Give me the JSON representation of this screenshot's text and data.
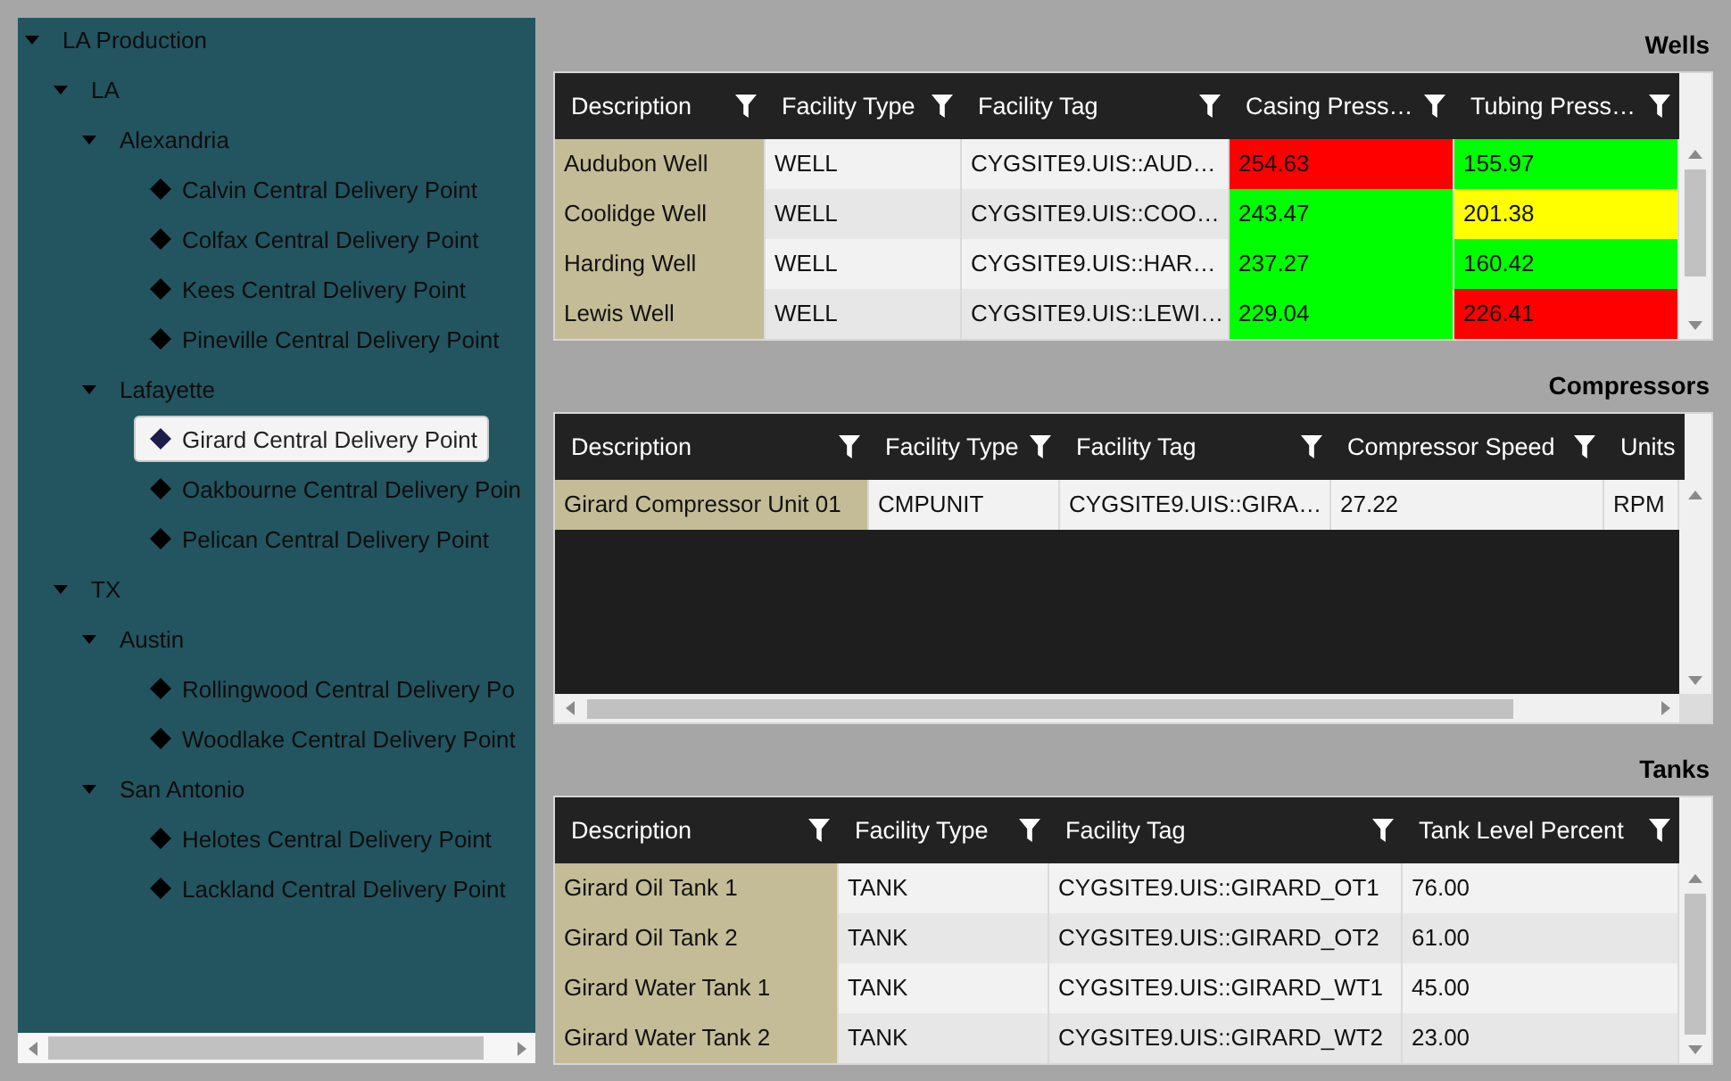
{
  "tree": [
    {
      "label": "LA Production",
      "expanded": true,
      "selected": false,
      "children": [
        {
          "label": "LA",
          "expanded": true,
          "selected": false,
          "children": [
            {
              "label": "Alexandria",
              "expanded": true,
              "selected": false,
              "children": [
                {
                  "label": "Calvin Central Delivery Point",
                  "selected": false
                },
                {
                  "label": "Colfax Central Delivery Point",
                  "selected": false
                },
                {
                  "label": "Kees Central Delivery Point",
                  "selected": false
                },
                {
                  "label": "Pineville Central Delivery Point",
                  "selected": false
                }
              ]
            },
            {
              "label": "Lafayette",
              "expanded": true,
              "selected": false,
              "children": [
                {
                  "label": "Girard Central Delivery Point",
                  "selected": true
                },
                {
                  "label": "Oakbourne Central Delivery Poin",
                  "selected": false
                },
                {
                  "label": "Pelican Central Delivery Point",
                  "selected": false
                }
              ]
            }
          ]
        },
        {
          "label": "TX",
          "expanded": true,
          "selected": false,
          "children": [
            {
              "label": "Austin",
              "expanded": true,
              "selected": false,
              "children": [
                {
                  "label": "Rollingwood Central Delivery Po",
                  "selected": false
                },
                {
                  "label": "Woodlake Central Delivery Point",
                  "selected": false
                }
              ]
            },
            {
              "label": "San Antonio",
              "expanded": true,
              "selected": false,
              "children": [
                {
                  "label": "Helotes Central Delivery Point",
                  "selected": false
                },
                {
                  "label": "Lackland Central Delivery Point",
                  "selected": false
                }
              ]
            }
          ]
        }
      ]
    }
  ],
  "sections": [
    {
      "title": "Wells",
      "horizontal_scroll": false,
      "columns": [
        {
          "label": "Description",
          "filter": true
        },
        {
          "label": "Facility Type",
          "filter": true
        },
        {
          "label": "Facility Tag",
          "filter": true
        },
        {
          "label": "Casing Press…",
          "filter": true
        },
        {
          "label": "Tubing Press…",
          "filter": true
        }
      ],
      "rows": [
        {
          "cells": [
            {
              "text": "Audubon Well"
            },
            {
              "text": "WELL"
            },
            {
              "text": "CYGSITE9.UIS::AUD…"
            },
            {
              "text": "254.63",
              "color": "#ff0000"
            },
            {
              "text": "155.97",
              "color": "#00ff00"
            }
          ]
        },
        {
          "cells": [
            {
              "text": "Coolidge Well"
            },
            {
              "text": "WELL"
            },
            {
              "text": "CYGSITE9.UIS::COO…"
            },
            {
              "text": "243.47",
              "color": "#00ff00"
            },
            {
              "text": "201.38",
              "color": "#ffff00"
            }
          ]
        },
        {
          "cells": [
            {
              "text": "Harding Well"
            },
            {
              "text": "WELL"
            },
            {
              "text": "CYGSITE9.UIS::HAR…"
            },
            {
              "text": "237.27",
              "color": "#00ff00"
            },
            {
              "text": "160.42",
              "color": "#00ff00"
            }
          ]
        },
        {
          "cells": [
            {
              "text": "Lewis Well"
            },
            {
              "text": "WELL"
            },
            {
              "text": "CYGSITE9.UIS::LEWI…"
            },
            {
              "text": "229.04",
              "color": "#00ff00"
            },
            {
              "text": "226.41",
              "color": "#ff0000"
            }
          ]
        }
      ]
    },
    {
      "title": "Compressors",
      "horizontal_scroll": true,
      "columns": [
        {
          "label": "Description",
          "filter": true
        },
        {
          "label": "Facility Type",
          "filter": true
        },
        {
          "label": "Facility Tag",
          "filter": true
        },
        {
          "label": "Compressor Speed",
          "filter": true
        },
        {
          "label": "Units",
          "filter": false
        }
      ],
      "rows": [
        {
          "cells": [
            {
              "text": "Girard Compressor Unit 01"
            },
            {
              "text": "CMPUNIT"
            },
            {
              "text": "CYGSITE9.UIS::GIRA…"
            },
            {
              "text": "27.22"
            },
            {
              "text": "RPM"
            }
          ]
        }
      ]
    },
    {
      "title": "Tanks",
      "horizontal_scroll": false,
      "columns": [
        {
          "label": "Description",
          "filter": true
        },
        {
          "label": "Facility Type",
          "filter": true
        },
        {
          "label": "Facility Tag",
          "filter": true
        },
        {
          "label": "Tank Level Percent",
          "filter": true
        }
      ],
      "rows": [
        {
          "cells": [
            {
              "text": "Girard Oil Tank 1"
            },
            {
              "text": "TANK"
            },
            {
              "text": "CYGSITE9.UIS::GIRARD_OT1"
            },
            {
              "text": "76.00"
            }
          ]
        },
        {
          "cells": [
            {
              "text": "Girard Oil Tank 2"
            },
            {
              "text": "TANK"
            },
            {
              "text": "CYGSITE9.UIS::GIRARD_OT2"
            },
            {
              "text": "61.00"
            }
          ]
        },
        {
          "cells": [
            {
              "text": "Girard Water Tank 1"
            },
            {
              "text": "TANK"
            },
            {
              "text": "CYGSITE9.UIS::GIRARD_WT1"
            },
            {
              "text": "45.00"
            }
          ]
        },
        {
          "cells": [
            {
              "text": "Girard Water Tank 2"
            },
            {
              "text": "TANK"
            },
            {
              "text": "CYGSITE9.UIS::GIRARD_WT2"
            },
            {
              "text": "23.00"
            }
          ]
        }
      ]
    }
  ]
}
